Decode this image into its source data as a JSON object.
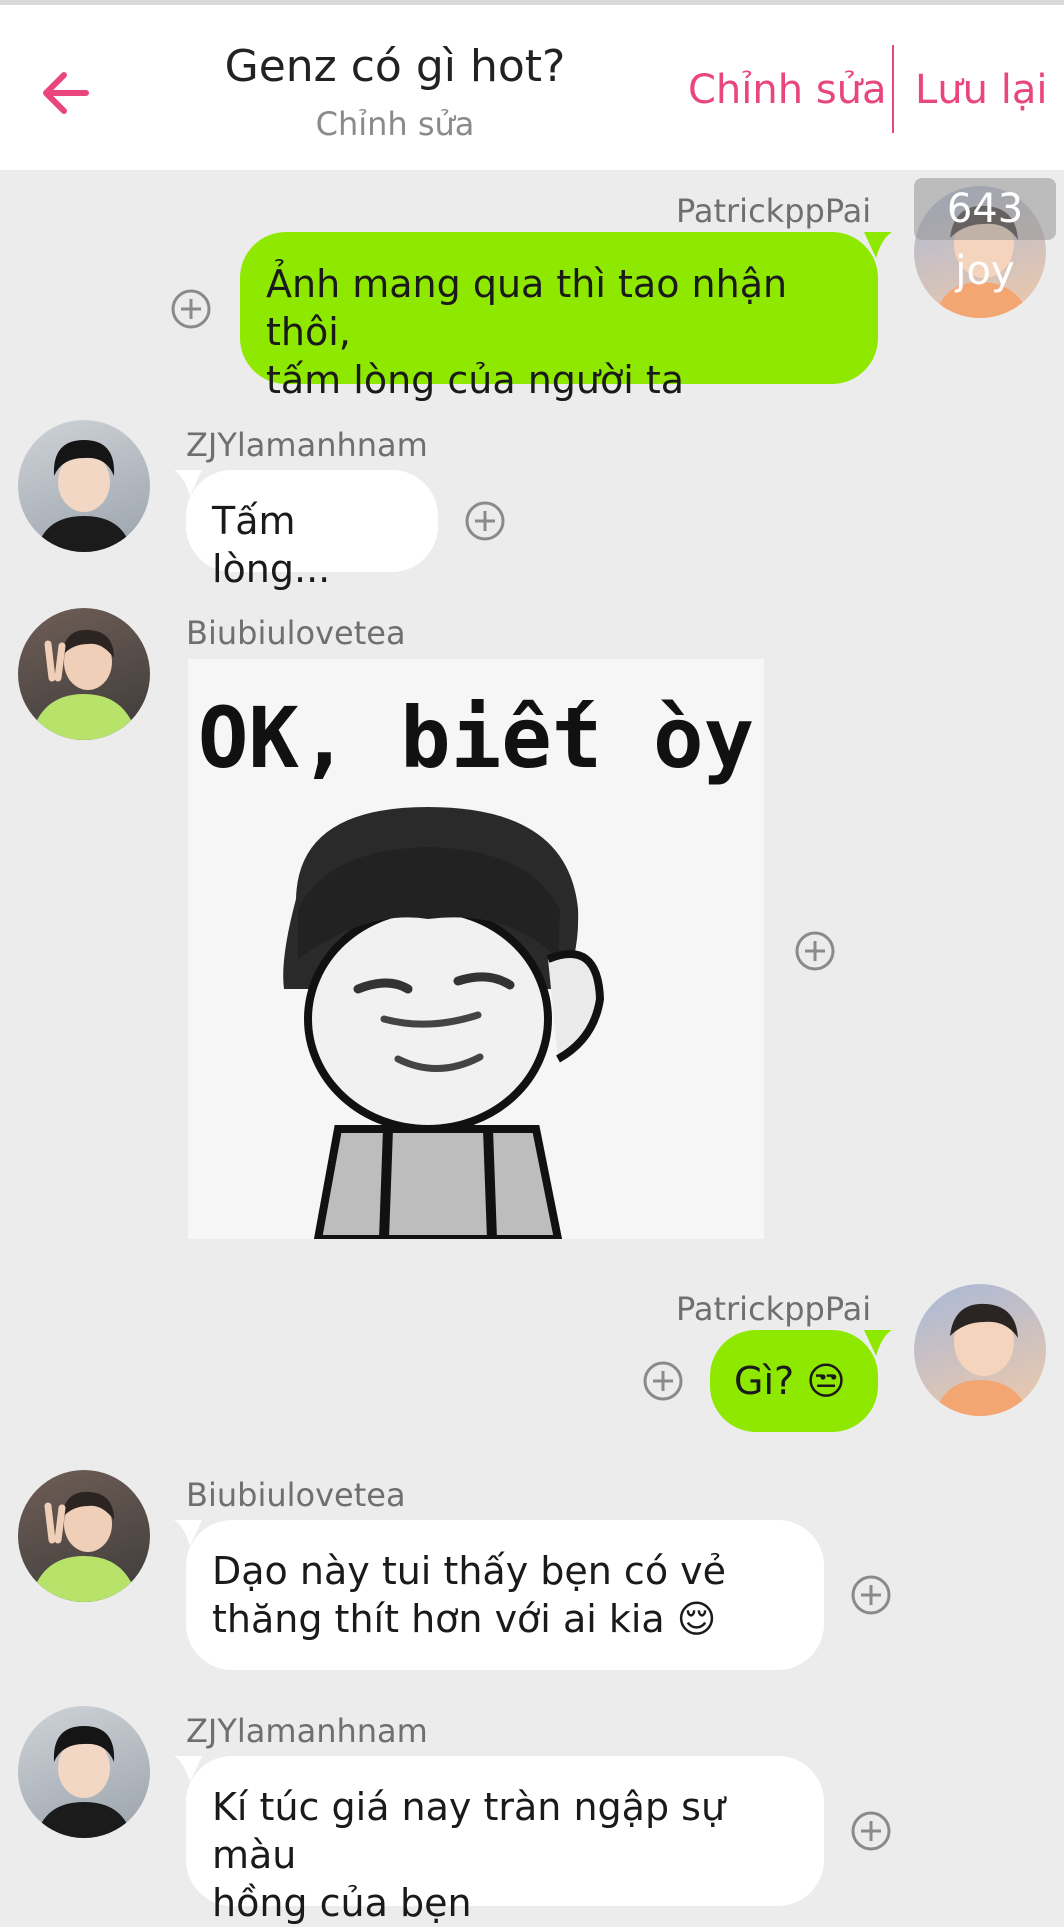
{
  "header": {
    "title": "Genz có gì hot?",
    "subtitle": "Chỉnh sửa",
    "edit_label": "Chỉnh sửa",
    "save_label": "Lưu lại",
    "accent_color": "#e8467d"
  },
  "messages": [
    {
      "sender": "PatrickppPai",
      "text_line1": "Ảnh mang qua thì tao nhận thôi,",
      "text_line2": "tấm lòng của người ta",
      "badge": "643 joy"
    },
    {
      "sender": "ZJYlamanhnam",
      "text": "Tấm lòng..."
    },
    {
      "sender": "Biubiulovetea",
      "sticker_text": "OK, biết òy"
    },
    {
      "sender": "PatrickppPai",
      "text": "Gì? 😒"
    },
    {
      "sender": "Biubiulovetea",
      "text_line1": "Dạo này tui thấy bẹn có vẻ",
      "text_line2": "thăng thít hơn với ai kia 😌"
    },
    {
      "sender": "ZJYlamanhnam",
      "text_line1": "Kí túc giá nay tràn ngập sự màu",
      "text_line2": "hồng của bẹn"
    }
  ],
  "colors": {
    "bubble_self": "#8fe800",
    "bubble_other": "#ffffff",
    "background": "#ececec"
  }
}
